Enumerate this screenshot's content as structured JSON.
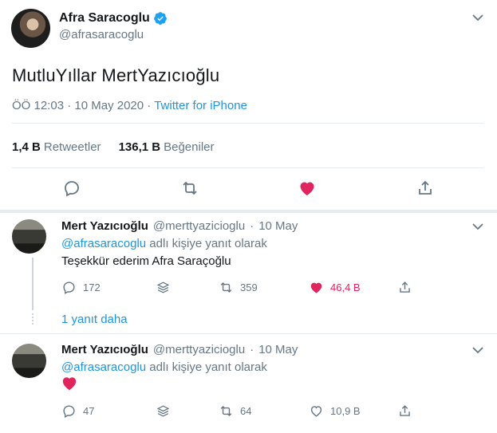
{
  "main_tweet": {
    "display_name": "Afra Saracoglu",
    "handle": "@afrasaracoglu",
    "text": "MutluYıllar MertYazıcıoğlu",
    "time": "ÖÖ 12:03",
    "date": "10 May 2020",
    "source": "Twitter for iPhone",
    "retweets_count": "1,4 B",
    "retweets_label": "Retweetler",
    "likes_count": "136,1 B",
    "likes_label": "Beğeniler"
  },
  "replies": [
    {
      "display_name": "Mert Yazıcıoğlu",
      "handle": "@merttyazicioglu",
      "date": "10 May",
      "reply_to_mention": "@afrasaracoglu",
      "reply_to_suffix": "adlı kişiye yanıt olarak",
      "text": "Teşekkür ederim Afra Saraçoğlu",
      "reply_count": "172",
      "retweet_count": "359",
      "like_count": "46,4 B",
      "more_replies": "1 yanıt daha"
    },
    {
      "display_name": "Mert Yazıcıoğlu",
      "handle": "@merttyazicioglu",
      "date": "10 May",
      "reply_to_mention": "@afrasaracoglu",
      "reply_to_suffix": "adlı kişiye yanıt olarak",
      "text_emoji": "heart",
      "reply_count": "47",
      "retweet_count": "64",
      "like_count": "10,9 B"
    }
  ],
  "separator": "·",
  "colors": {
    "accent": "#1b95e0",
    "like": "#e0245e",
    "muted": "#657786",
    "divider": "#e6ecf0"
  }
}
